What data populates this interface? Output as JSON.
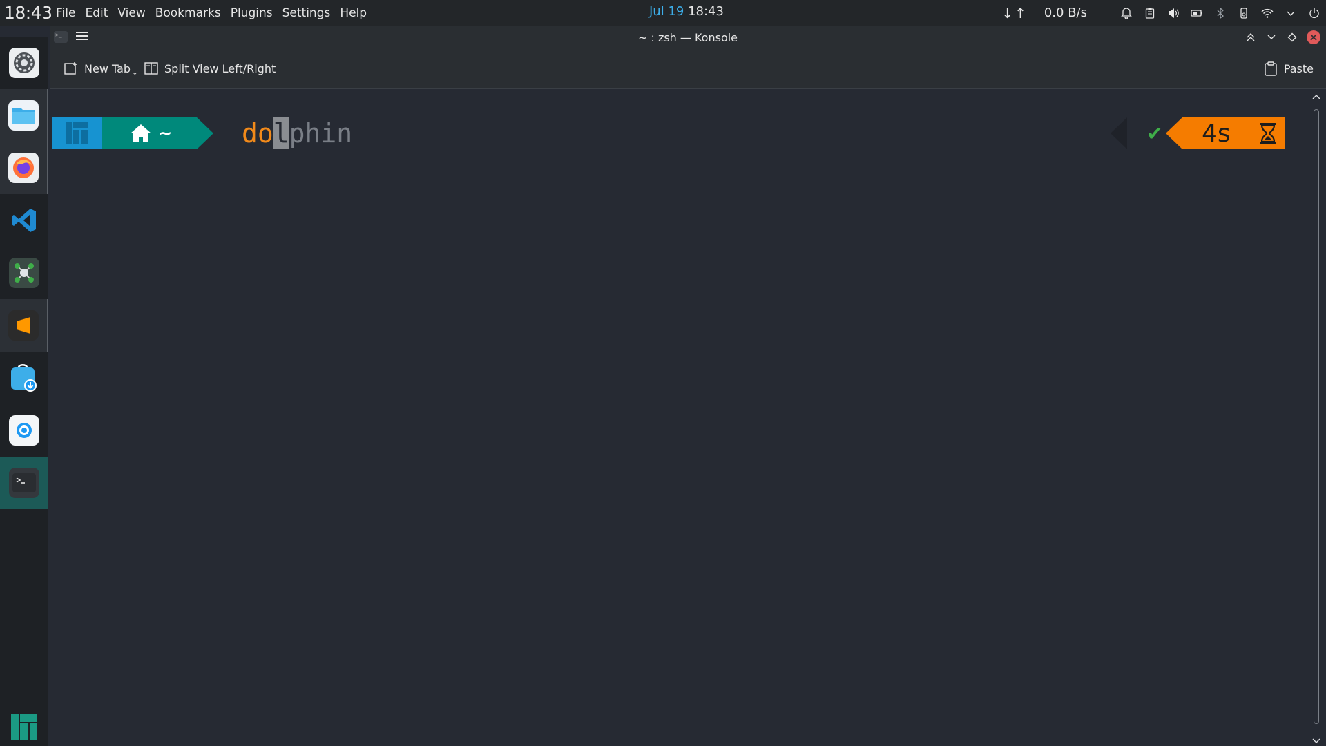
{
  "top_panel": {
    "clock": "18:43",
    "menu": [
      "File",
      "Edit",
      "View",
      "Bookmarks",
      "Plugins",
      "Settings",
      "Help"
    ],
    "center_date": "Jul 19",
    "center_time": "18:43",
    "net_arrows": "↓↑",
    "net_speed": "0.0 B/s",
    "tray_icons": [
      "bell-icon",
      "clipboard-icon",
      "volume-icon",
      "battery-icon",
      "bluetooth-icon",
      "device-icon",
      "wifi-icon",
      "chevron-down-icon",
      "power-icon"
    ],
    "accent": "#3daee9"
  },
  "dock": {
    "items": [
      "system-settings-icon",
      "files-icon",
      "firefox-icon",
      "vscode-icon",
      "molecule-app-icon",
      "sublime-text-icon",
      "software-store-icon",
      "web-browser-icon",
      "terminal-icon"
    ],
    "active_item": "terminal-icon",
    "active_color": "#1c5a57"
  },
  "window": {
    "title": "~ : zsh — Konsole",
    "toolbar": {
      "new_tab": "New Tab",
      "split_view": "Split View Left/Right",
      "paste": "Paste"
    }
  },
  "terminal": {
    "dir_segment": "~",
    "cmd_typed": "do",
    "cmd_cursor_char": "l",
    "cmd_suggestion": "phin",
    "status": "✔",
    "elapsed": "4s",
    "colors": {
      "os_segment": "#1793d1",
      "dir_segment": "#00897b",
      "time_segment": "#f57c00",
      "command": "#f28a1a",
      "success": "#3fae49"
    }
  }
}
